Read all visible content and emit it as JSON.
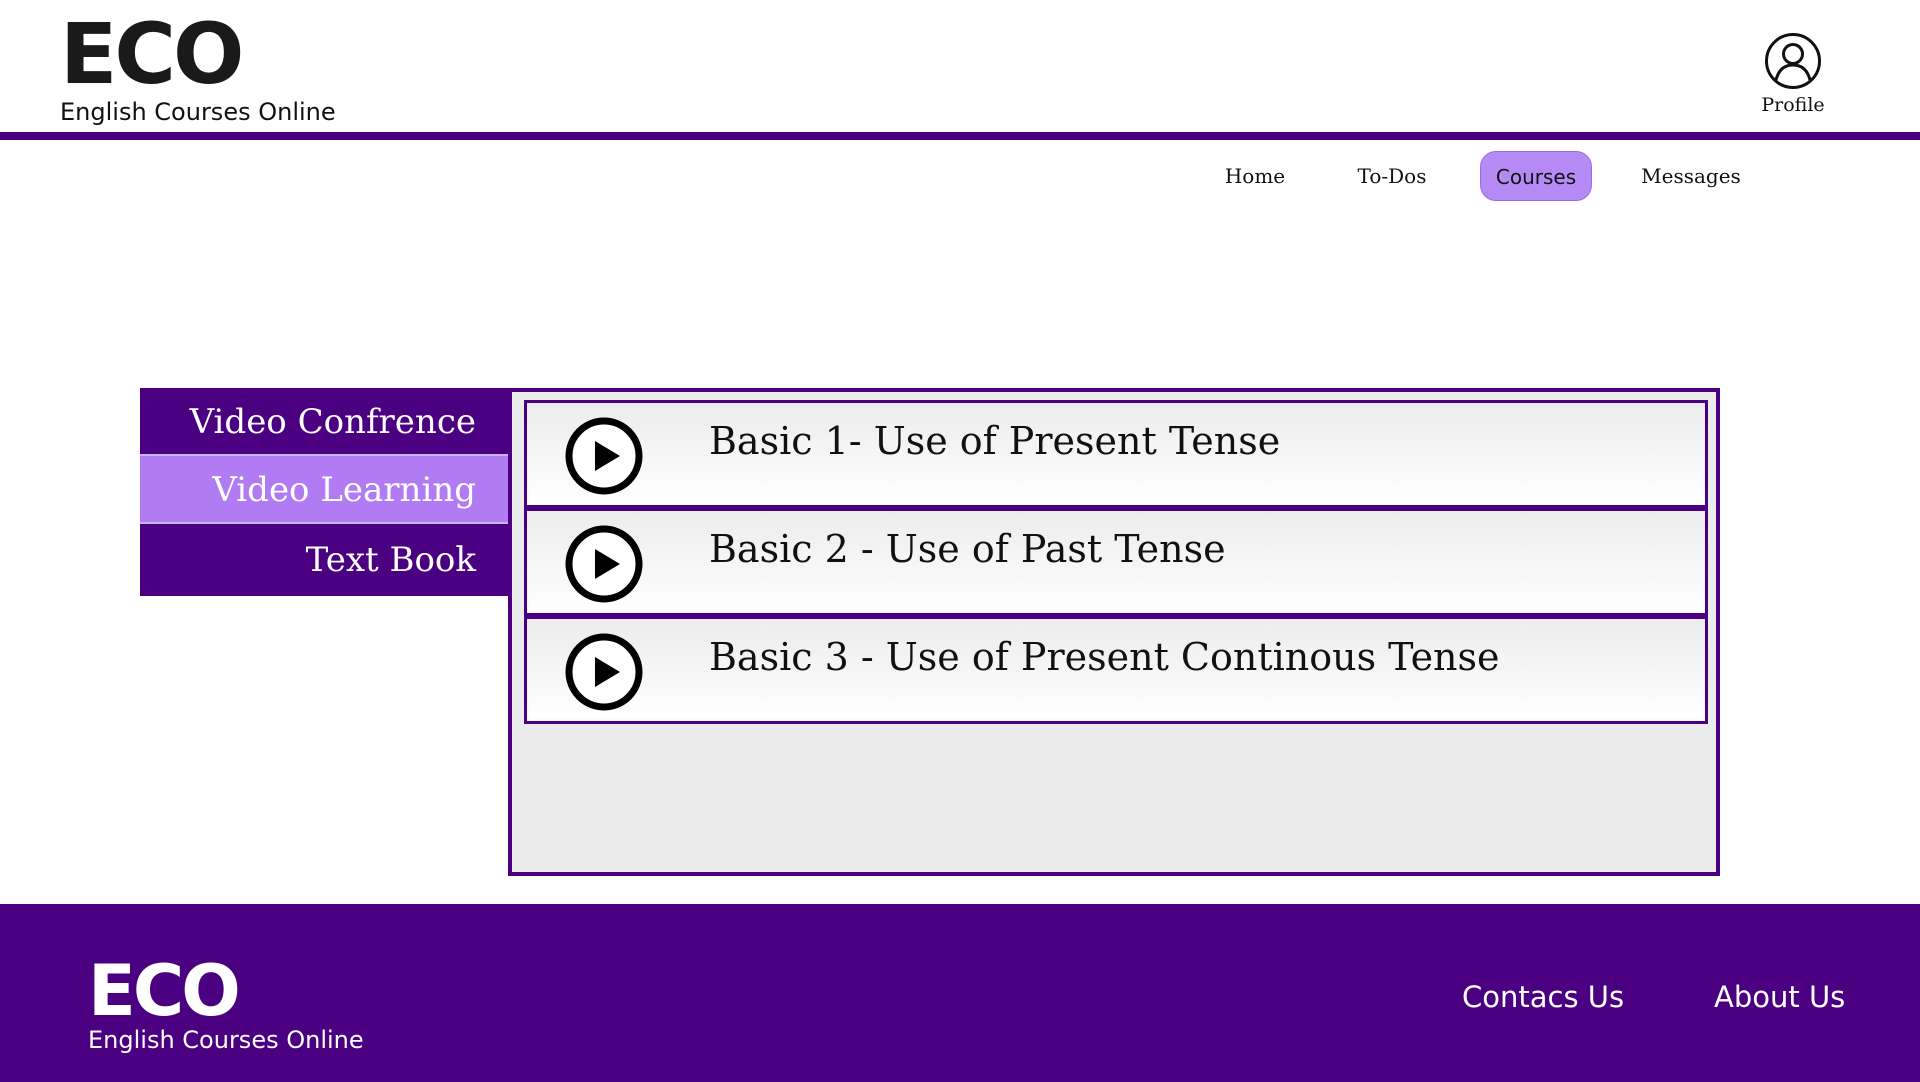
{
  "brand": {
    "logo_text": "ECO",
    "tagline": "English Courses Online"
  },
  "profile": {
    "label": "Profile",
    "icon": "user-circle-icon"
  },
  "nav": {
    "items": [
      {
        "label": "Home"
      },
      {
        "label": "To-Dos"
      },
      {
        "label": "Courses",
        "active": true
      },
      {
        "label": "Messages"
      }
    ]
  },
  "side_menu": {
    "items": [
      {
        "label": "Video Confrence"
      },
      {
        "label": "Video Learning",
        "active": true
      },
      {
        "label": "Text Book"
      }
    ]
  },
  "lessons": [
    {
      "title": "Basic 1- Use of Present Tense",
      "icon": "play-circle-icon"
    },
    {
      "title": "Basic 2 - Use of Past Tense",
      "icon": "play-circle-icon"
    },
    {
      "title": "Basic 3 - Use of Present Continous Tense",
      "icon": "play-circle-icon"
    }
  ],
  "footer": {
    "logo_text": "ECO",
    "tagline": "English Courses Online",
    "links": [
      {
        "label": "Contacs Us"
      },
      {
        "label": "About Us"
      }
    ]
  },
  "colors": {
    "primary": "#4b0082",
    "accent": "#b17bf3",
    "panel_bg": "#ebebeb"
  }
}
